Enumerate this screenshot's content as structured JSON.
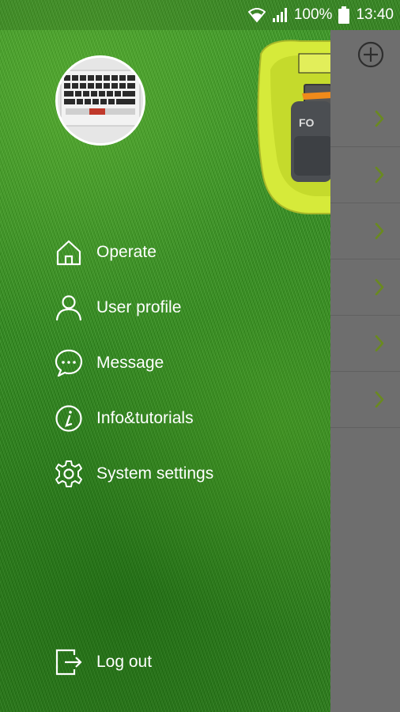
{
  "status_bar": {
    "wifi_icon": "wifi-icon",
    "signal_icon": "signal-icon",
    "battery_percent": "100%",
    "battery_icon": "battery-icon",
    "time": "13:40"
  },
  "drawer": {
    "avatar_icon": "keyboard-photo",
    "menu": [
      {
        "label": "Operate",
        "icon": "home-icon"
      },
      {
        "label": "User profile",
        "icon": "user-icon"
      },
      {
        "label": "Message",
        "icon": "message-icon"
      },
      {
        "label": "Info&tutorials",
        "icon": "info-icon"
      },
      {
        "label": "System settings",
        "icon": "gear-icon"
      }
    ],
    "logout": {
      "label": "Log out",
      "icon": "logout-icon"
    }
  },
  "main": {
    "add_icon": "plus-circle-icon",
    "rows": 6,
    "chevron_icon": "chevron-right-icon"
  },
  "colors": {
    "grass": "#2f8a1e",
    "panel": "#6e6e6e",
    "chevron": "#6a8a1f",
    "mower": "#d6ea3a"
  }
}
